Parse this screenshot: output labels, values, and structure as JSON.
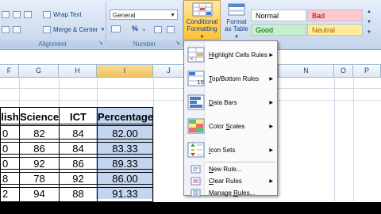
{
  "ribbon": {
    "wrap_text": "Wrap Text",
    "merge_center": "Merge & Center",
    "alignment_label": "Alignment",
    "number_format": "General",
    "number_label": "Number",
    "currency_symbol": "$",
    "percent_symbol": "%",
    "comma_symbol": ",",
    "conditional_formatting": [
      "Conditional",
      "Formatting"
    ],
    "format_as_table": [
      "Format",
      "as Table"
    ],
    "styles": {
      "normal": "Normal",
      "bad": "Bad",
      "good": "Good",
      "neutral": "Neutral"
    }
  },
  "columns": [
    "F",
    "G",
    "H",
    "I",
    "J",
    "N",
    "O",
    "P"
  ],
  "table": {
    "headers": [
      "lish",
      "Science",
      "ICT",
      "Percentage"
    ],
    "rows": [
      [
        "0",
        "82",
        "84",
        "82.00"
      ],
      [
        "0",
        "86",
        "84",
        "83.33"
      ],
      [
        "0",
        "92",
        "86",
        "89.33"
      ],
      [
        "8",
        "78",
        "92",
        "86.00"
      ],
      [
        "2",
        "94",
        "88",
        "91.33"
      ]
    ]
  },
  "menu": {
    "items": [
      {
        "label": "Highlight Cells Rules",
        "u": "H",
        "rest": "ighlight Cells Rules",
        "icon": "highlight-cells-icon",
        "submenu": true
      },
      {
        "label": "Top/Bottom Rules",
        "u": "T",
        "rest": "op/Bottom Rules",
        "icon": "top-bottom-icon",
        "submenu": true
      },
      {
        "label": "Data Bars",
        "u": "D",
        "rest": "ata Bars",
        "icon": "data-bars-icon",
        "submenu": true
      },
      {
        "label": "Color Scales",
        "u": "S",
        "pre": "Color ",
        "rest": "cales",
        "icon": "color-scales-icon",
        "submenu": true
      },
      {
        "label": "Icon Sets",
        "u": "I",
        "rest": "con Sets",
        "icon": "icon-sets-icon",
        "submenu": true
      }
    ],
    "small_items": [
      {
        "label": "New Rule...",
        "u": "N",
        "rest": "ew Rule...",
        "icon": "new-rule-icon",
        "submenu": false
      },
      {
        "label": "Clear Rules",
        "u": "C",
        "rest": "lear Rules",
        "icon": "clear-rules-icon",
        "submenu": true
      },
      {
        "label": "Manage Rules...",
        "u": "R",
        "pre": "Manage ",
        "rest": "ules...",
        "icon": "manage-rules-icon",
        "submenu": false
      }
    ]
  },
  "colors": {
    "selected_column": "#c4d5ef",
    "good_bg": "#c6efce",
    "good_fg": "#006100",
    "bad_bg": "#ffc7ce",
    "bad_fg": "#9c0006",
    "neutral_bg": "#ffeb9c",
    "neutral_fg": "#9c6500"
  }
}
